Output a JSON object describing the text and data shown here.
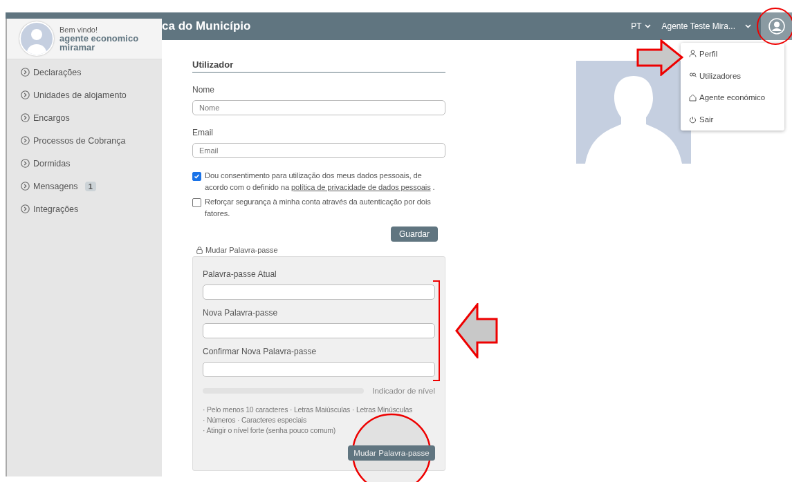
{
  "top_bar": {
    "title": "ca do Município",
    "language": "PT",
    "user_name": "Agente Teste Mira..."
  },
  "sidebar": {
    "greeting": "Bem vindo!",
    "user": "agente economico miramar",
    "items": [
      {
        "label": "Declarações"
      },
      {
        "label": "Unidades de alojamento"
      },
      {
        "label": "Encargos"
      },
      {
        "label": "Processos de Cobrança"
      },
      {
        "label": "Dormidas"
      },
      {
        "label": "Mensagens",
        "badge": "1"
      },
      {
        "label": "Integrações"
      }
    ]
  },
  "user_menu": {
    "items": [
      {
        "label": "Perfil"
      },
      {
        "label": "Utilizadores"
      },
      {
        "label": "Agente económico"
      },
      {
        "label": "Sair"
      }
    ]
  },
  "form": {
    "section_title": "Utilizador",
    "fields": [
      {
        "label": "Nome",
        "placeholder": "Nome"
      },
      {
        "label": "Email",
        "placeholder": "Email"
      }
    ],
    "consents": [
      {
        "text": "Dou consentimento para utilização dos meus dados pessoais, de acordo com o definido na ",
        "link": "política de privacidade de dados pessoais",
        "after": " .",
        "checked": true
      },
      {
        "text": "Reforçar segurança à minha conta através da autenticação por dois fatores.",
        "checked": false
      }
    ],
    "save_button": "Guardar"
  },
  "password": {
    "toggle": "Mudar Palavra-passe",
    "fields": [
      {
        "label": "Palavra-passe Atual"
      },
      {
        "label": "Nova Palavra-passe"
      },
      {
        "label": "Confirmar Nova Palavra-passe"
      }
    ],
    "strength": {
      "level": 0,
      "label": "Indicador de nível"
    },
    "hints": [
      "· Pelo menos 10 caracteres · Letras Maiúsculas · Letras Minúsculas",
      "· Números · Caracteres especiais",
      "· Atingir o nível forte (senha pouco comum)"
    ],
    "button": "Mudar Palavra-passe"
  }
}
